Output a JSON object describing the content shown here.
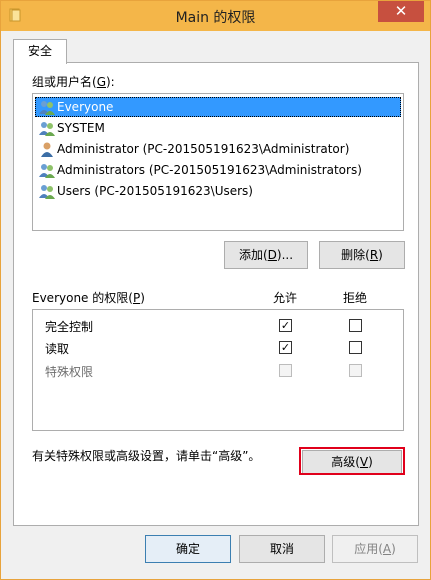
{
  "window": {
    "title": "Main 的权限",
    "close_label": "✕"
  },
  "tabs": [
    {
      "label": "安全",
      "selected": true
    }
  ],
  "group_section": {
    "label": "组或用户名(",
    "hotkey": "G",
    "label_suffix": "):",
    "users": [
      {
        "name": "Everyone",
        "selected": true
      },
      {
        "name": "SYSTEM",
        "selected": false
      },
      {
        "name": "Administrator (PC-201505191623\\Administrator)",
        "selected": false
      },
      {
        "name": "Administrators (PC-201505191623\\Administrators)",
        "selected": false
      },
      {
        "name": "Users (PC-201505191623\\Users)",
        "selected": false
      }
    ]
  },
  "buttons": {
    "add_prefix": "添加(",
    "add_hotkey": "D",
    "add_suffix": ")...",
    "remove_prefix": "删除(",
    "remove_hotkey": "R",
    "remove_suffix": ")",
    "advanced_prefix": "高级(",
    "advanced_hotkey": "V",
    "advanced_suffix": ")"
  },
  "permissions": {
    "header_prefix": "Everyone 的权限(",
    "header_hotkey": "P",
    "header_suffix": ")",
    "allow_header": "允许",
    "deny_header": "拒绝",
    "rows": [
      {
        "name": "完全控制",
        "allow": true,
        "deny": false,
        "enabled": true
      },
      {
        "name": "读取",
        "allow": true,
        "deny": false,
        "enabled": true
      },
      {
        "name": "特殊权限",
        "allow": false,
        "deny": false,
        "enabled": false
      }
    ]
  },
  "advanced_note": "有关特殊权限或高级设置，请单击“高级”。",
  "footer": {
    "ok": "确定",
    "cancel": "取消",
    "apply_prefix": "应用(",
    "apply_hotkey": "A",
    "apply_suffix": ")"
  },
  "colors": {
    "titlebar": "#f4b649",
    "selection": "#3399ff",
    "highlight_box": "#e0001b"
  }
}
